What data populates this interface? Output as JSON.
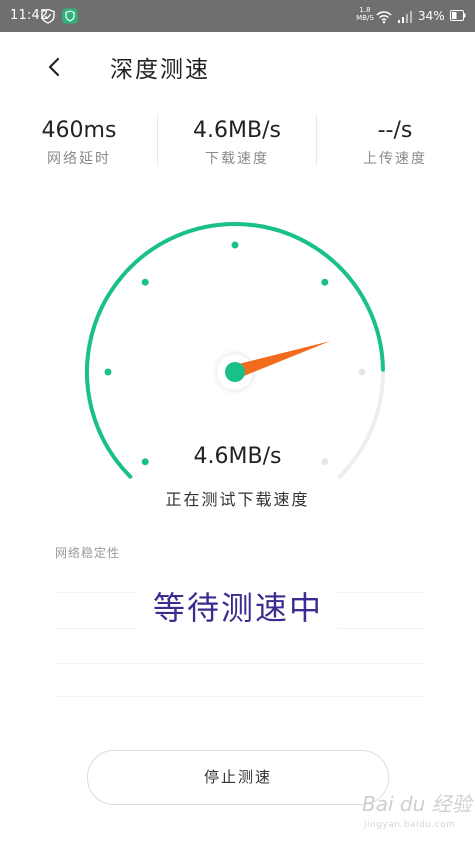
{
  "status_bar": {
    "time": "11:42",
    "net_speed_top": "1.8",
    "net_speed_unit": "MB/S",
    "battery": "34%"
  },
  "header": {
    "title": "深度测速",
    "back_icon": "chevron-left-icon"
  },
  "stats": {
    "latency": {
      "value": "460ms",
      "label": "网络延时"
    },
    "download": {
      "value": "4.6MB/s",
      "label": "下载速度"
    },
    "upload": {
      "value": "--/s",
      "label": "上传速度"
    }
  },
  "gauge": {
    "speed": "4.6MB/s",
    "status": "正在测试下载速度",
    "progress": 0.83,
    "accent_color": "#19c08a",
    "needle_color": "#f36b1c"
  },
  "stability": {
    "title": "网络稳定性",
    "waiting_text": "等待测速中"
  },
  "stop_button": {
    "label": "停止测速"
  },
  "watermark": {
    "brand": "Bai du 经验",
    "url": "jingyan.baidu.com"
  }
}
